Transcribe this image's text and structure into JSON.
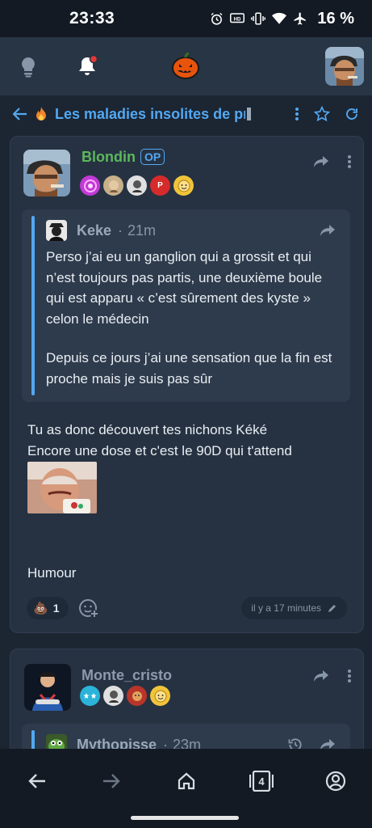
{
  "status_bar": {
    "time": "23:33",
    "battery": "16 %"
  },
  "header": {
    "logo_icon": "pumpkin-icon",
    "notification_dot_color": "#e53935"
  },
  "topic": {
    "title": "Les maladies insolites de pr"
  },
  "posts": [
    {
      "username": "Blondin",
      "username_color": "#5cb85c",
      "op_label": "OP",
      "quote": {
        "username": "Keke",
        "time": "21m",
        "paragraphs": [
          "Perso j’ai eu un ganglion qui a grossit et qui n’est toujours pas partis, une deuxième boule qui est apparu « c’est sûrement des kyste » celon le médecin",
          "Depuis ce jours j’ai une sensation que la fin est proche mais je suis pas sûr"
        ]
      },
      "body_lines": [
        "Tu as donc découvert tes nichons Kéké",
        "Encore une dose et c'est le 90D qui t'attend"
      ],
      "body_footer": "Humour",
      "reaction": {
        "emoji": "💩",
        "count": "1"
      },
      "timestamp": "il y a 17 minutes"
    },
    {
      "username": "Monte_cristo",
      "username_color": "#8d9aab",
      "quote": {
        "username": "Mythopisse",
        "time": "23m"
      }
    }
  ],
  "bottom_nav": {
    "tabs_count": "4"
  }
}
